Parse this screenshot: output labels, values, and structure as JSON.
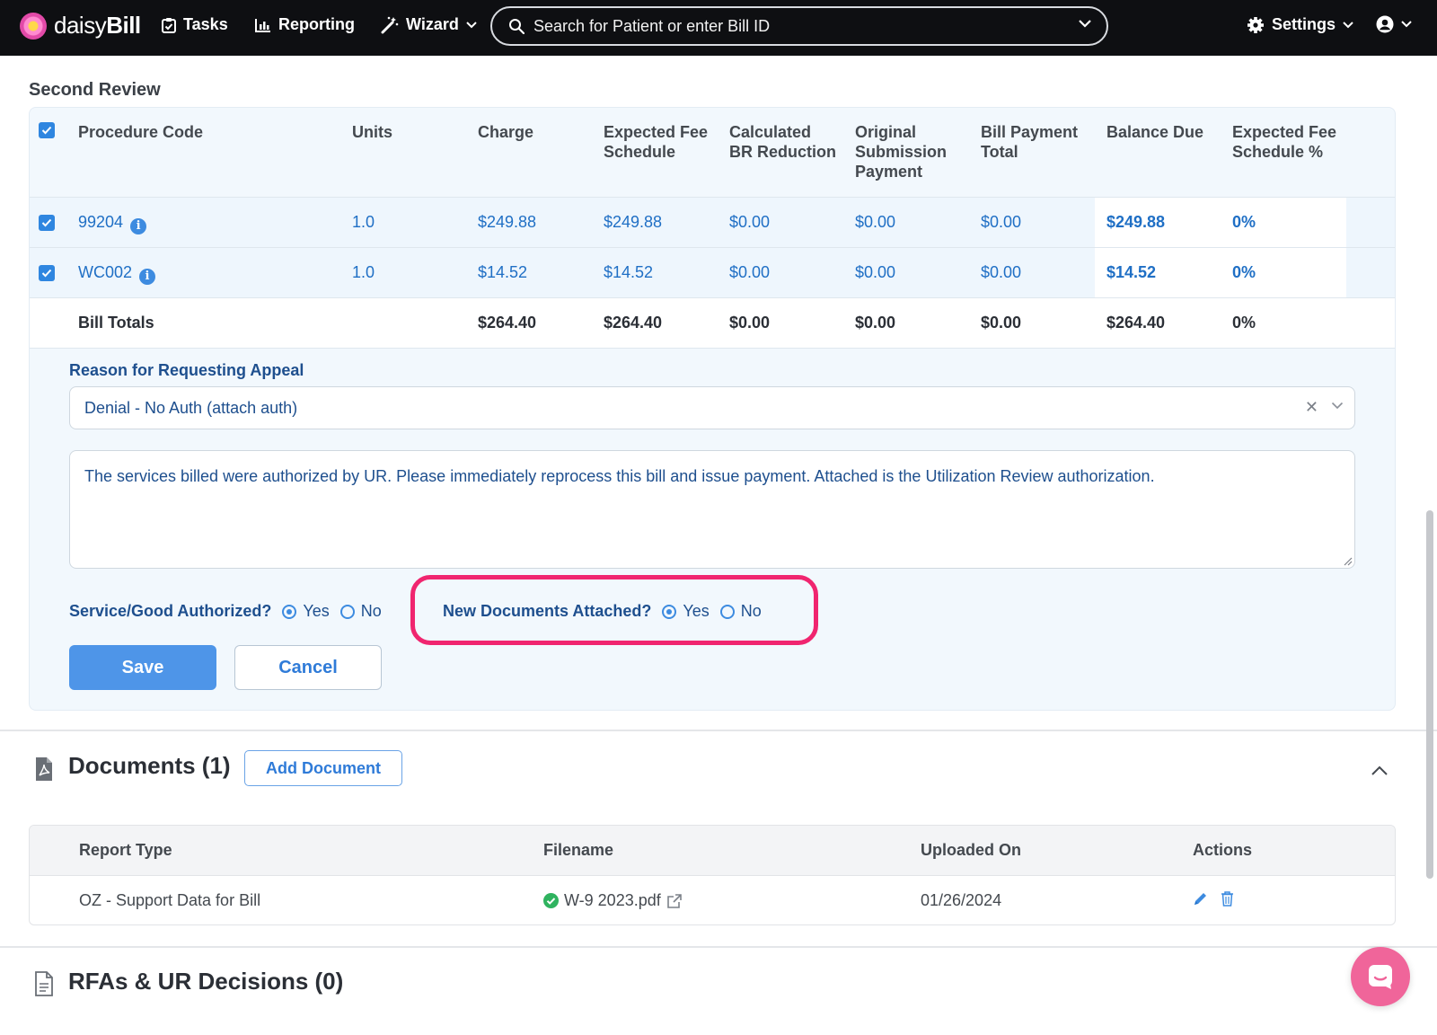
{
  "nav": {
    "logo": "daisyBill",
    "tasks": "Tasks",
    "reporting": "Reporting",
    "wizard": "Wizard",
    "search_placeholder": "Search for Patient or enter Bill ID",
    "settings": "Settings"
  },
  "second_review": {
    "title": "Second Review",
    "columns": [
      "Procedure Code",
      "Units",
      "Charge",
      "Expected Fee\nSchedule",
      "Calculated\nBR Reduction",
      "Original\nSubmission\nPayment",
      "Bill Payment\nTotal",
      "Balance Due",
      "Expected Fee\nSchedule %"
    ],
    "rows": [
      {
        "code": "99204",
        "units": "1.0",
        "charge": "$249.88",
        "expected": "$249.88",
        "br": "$0.00",
        "original": "$0.00",
        "payment": "$0.00",
        "balance": "$249.88",
        "pct": "0%"
      },
      {
        "code": "WC002",
        "units": "1.0",
        "charge": "$14.52",
        "expected": "$14.52",
        "br": "$0.00",
        "original": "$0.00",
        "payment": "$0.00",
        "balance": "$14.52",
        "pct": "0%"
      }
    ],
    "totals": {
      "label": "Bill Totals",
      "charge": "$264.40",
      "expected": "$264.40",
      "br": "$0.00",
      "original": "$0.00",
      "payment": "$0.00",
      "balance": "$264.40",
      "pct": "0%"
    },
    "reason_label": "Reason for Requesting Appeal",
    "reason_value": "Denial - No Auth (attach auth)",
    "comment": "The services billed were authorized by UR. Please immediately reprocess this bill and issue payment. Attached is the Utilization Review authorization.",
    "authorized_label": "Service/Good Authorized?",
    "new_docs_label": "New Documents Attached?",
    "yes": "Yes",
    "no": "No",
    "save": "Save",
    "cancel": "Cancel"
  },
  "documents": {
    "title": "Documents (1)",
    "add": "Add Document",
    "headers": {
      "type": "Report Type",
      "filename": "Filename",
      "uploaded": "Uploaded On",
      "actions": "Actions"
    },
    "row": {
      "type": "OZ - Support Data for Bill",
      "filename": "W-9 2023.pdf",
      "uploaded": "01/26/2024"
    }
  },
  "rfas": {
    "title": "RFAs & UR Decisions (0)"
  },
  "colors": {
    "accent": "#2f86e0",
    "highlight": "#f0256f",
    "chat": "#f0659a"
  }
}
